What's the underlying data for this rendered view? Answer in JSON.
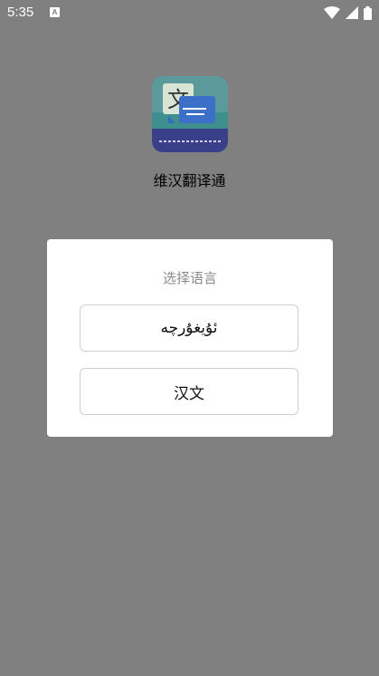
{
  "status_bar": {
    "time": "5:35",
    "notification_icon": "a-notification-icon",
    "icons": [
      "wifi-icon",
      "signal-icon",
      "battery-icon"
    ]
  },
  "app": {
    "name": "维汉翻译通",
    "icon": "translator-app-icon",
    "icon_glyph": "文"
  },
  "dialog": {
    "title": "选择语言",
    "options": [
      "ئۇيغۇرچە",
      "汉文"
    ]
  },
  "colors": {
    "overlay": "#808080",
    "dialog_bg": "#ffffff",
    "title_text": "#8a8a8a",
    "button_border": "#cfcfcf"
  }
}
